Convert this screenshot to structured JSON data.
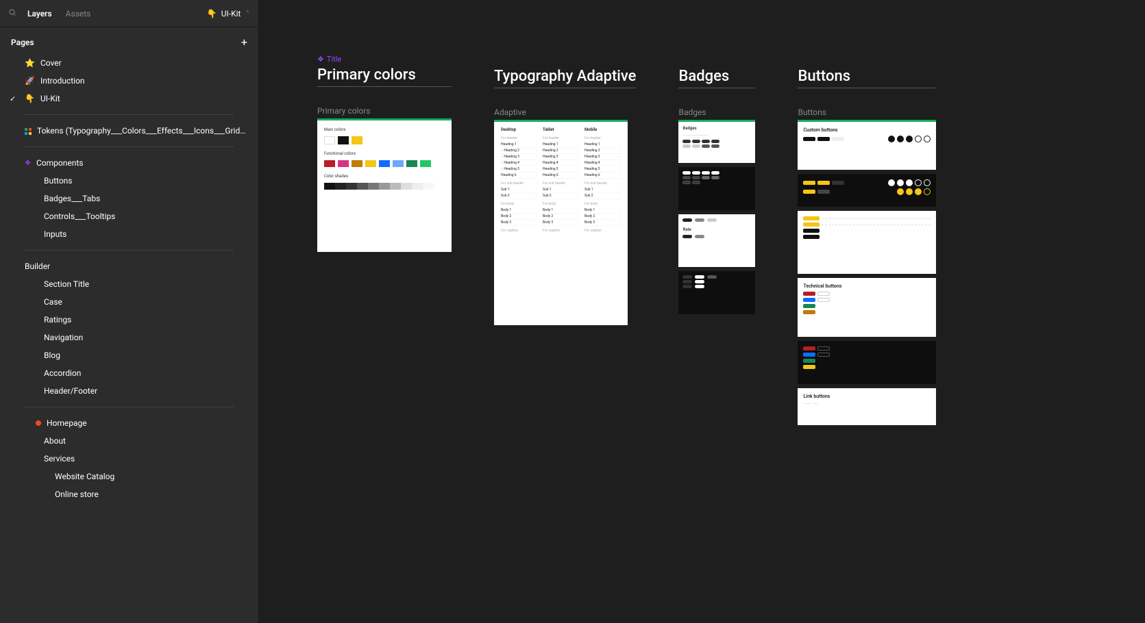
{
  "header": {
    "tab_layers": "Layers",
    "tab_assets": "Assets",
    "file_name": "UI-Kit",
    "file_emoji": "👇"
  },
  "pages": {
    "title": "Pages",
    "items": [
      {
        "emoji": "⭐",
        "label": "Cover",
        "indent": 0
      },
      {
        "emoji": "🚀",
        "label": "Introduction",
        "indent": 0
      },
      {
        "emoji": "👇",
        "label": "UI-Kit",
        "indent": 0,
        "selected": true
      },
      {
        "divider": true
      },
      {
        "emoji": "token",
        "label": "Tokens (Typography___Colors___Effects___Icons___Grids & Spaci...",
        "indent": 0
      },
      {
        "divider": true
      },
      {
        "emoji": "comp",
        "label": "Components",
        "indent": 0
      },
      {
        "label": "Buttons",
        "indent": 2
      },
      {
        "label": "Badges___Tabs",
        "indent": 2
      },
      {
        "label": "Controls___Tooltips",
        "indent": 2
      },
      {
        "label": "Inputs",
        "indent": 2
      },
      {
        "divider": true
      },
      {
        "label": "Builder",
        "indent": 0,
        "section": true
      },
      {
        "label": "Section Title",
        "indent": 2
      },
      {
        "label": "Case",
        "indent": 2
      },
      {
        "label": "Ratings",
        "indent": 2
      },
      {
        "label": "Navigation",
        "indent": 2
      },
      {
        "label": "Blog",
        "indent": 2
      },
      {
        "label": "Accordion",
        "indent": 2
      },
      {
        "label": "Header/Footer",
        "indent": 2
      },
      {
        "divider": true
      },
      {
        "emoji": "dot",
        "label": "Homepage",
        "indent": 1
      },
      {
        "label": "About",
        "indent": 2
      },
      {
        "label": "Services",
        "indent": 2
      },
      {
        "label": "Website Catalog",
        "indent": 3
      },
      {
        "label": "Online store",
        "indent": 3
      }
    ]
  },
  "canvas": {
    "title_badge": "Title",
    "sections": {
      "primary_colors": {
        "title": "Primary colors",
        "frame_label": "Primary colors",
        "main_colors": "Main colors",
        "functional_colors": "Functional colors",
        "color_shades": "Color shades",
        "main_swatches": [
          "#ffffff",
          "#111111",
          "#f5c518"
        ],
        "functional_swatches": [
          "#b81d24",
          "#d63384",
          "#c07b00",
          "#f5c518",
          "#0d6efd",
          "#6ea8fe",
          "#198754",
          "#20c763"
        ],
        "shades": [
          "#111",
          "#222",
          "#333",
          "#555",
          "#777",
          "#999",
          "#bbb",
          "#ddd",
          "#eee",
          "#f7f7f7"
        ]
      },
      "typography": {
        "title": "Typography Adaptive",
        "frame_label": "Adaptive",
        "cols": [
          "Desktop",
          "Tablet",
          "Mobile"
        ],
        "blocks": [
          {
            "label": "For header",
            "rows": [
              "Heading 1",
              "Heading 2",
              "Heading 3",
              "Heading 4",
              "Heading 5",
              "Heading 6"
            ],
            "checked": [
              1,
              2,
              3,
              4
            ]
          },
          {
            "label": "For sub header",
            "rows": [
              "Sub 1",
              "Sub 2"
            ]
          },
          {
            "label": "For body",
            "rows": [
              "Body 1",
              "Body 2",
              "Body 3"
            ]
          },
          {
            "label": "For caption",
            "rows": []
          }
        ]
      },
      "badges": {
        "title": "Badges",
        "frame_label": "Badges",
        "badges_heading": "Badges",
        "rate_heading": "Rate"
      },
      "buttons": {
        "title": "Buttons",
        "frame_label": "Buttons",
        "custom_heading": "Custom buttons",
        "technical_heading": "Technical buttons",
        "link_heading": "Link buttons"
      }
    }
  }
}
